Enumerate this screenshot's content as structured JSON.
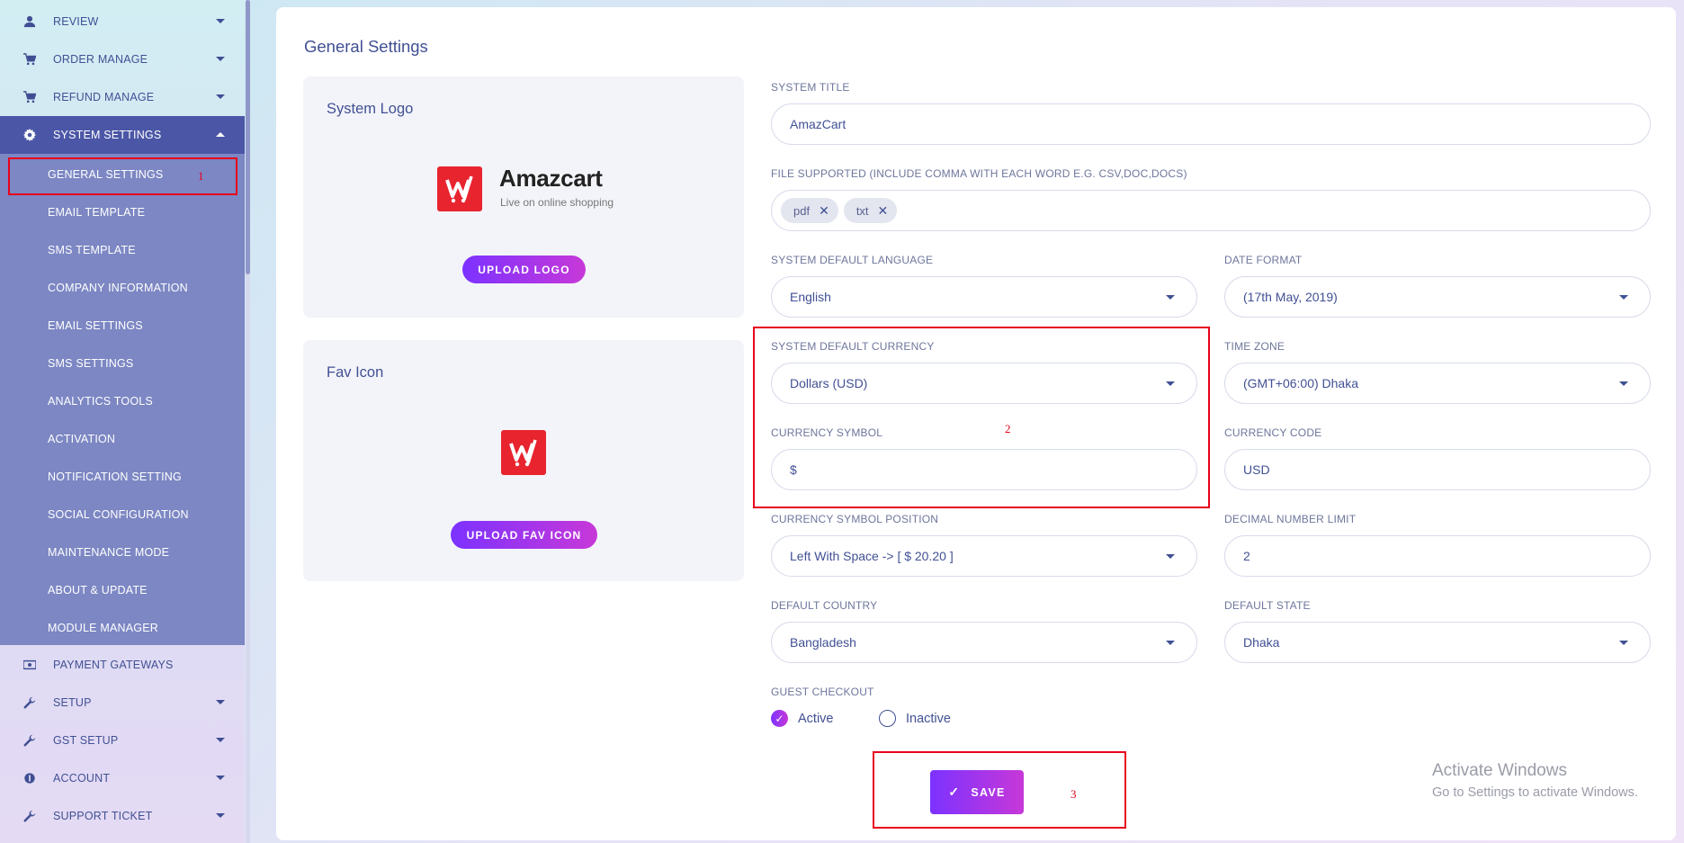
{
  "sidebar": {
    "top_items": [
      {
        "label": "REVIEW",
        "icon": "user-icon",
        "has_caret": true
      },
      {
        "label": "ORDER MANAGE",
        "icon": "cart-icon",
        "has_caret": true
      },
      {
        "label": "REFUND MANAGE",
        "icon": "cart-icon",
        "has_caret": true
      },
      {
        "label": "SYSTEM SETTINGS",
        "icon": "gear-icon",
        "has_caret": true,
        "active": true
      }
    ],
    "submenu": [
      "GENERAL SETTINGS",
      "EMAIL TEMPLATE",
      "SMS TEMPLATE",
      "COMPANY INFORMATION",
      "EMAIL SETTINGS",
      "SMS SETTINGS",
      "ANALYTICS TOOLS",
      "ACTIVATION",
      "NOTIFICATION SETTING",
      "SOCIAL CONFIGURATION",
      "MAINTENANCE MODE",
      "ABOUT & UPDATE",
      "MODULE MANAGER"
    ],
    "bottom_items": [
      {
        "label": "PAYMENT GATEWAYS",
        "icon": "money-icon",
        "has_caret": false
      },
      {
        "label": "SETUP",
        "icon": "wrench-icon",
        "has_caret": true
      },
      {
        "label": "GST SETUP",
        "icon": "wrench-icon",
        "has_caret": true
      },
      {
        "label": "ACCOUNT",
        "icon": "coin-icon",
        "has_caret": true
      },
      {
        "label": "SUPPORT TICKET",
        "icon": "wrench-icon",
        "has_caret": true
      }
    ]
  },
  "page": {
    "title": "General Settings"
  },
  "logo_panel": {
    "title": "System Logo",
    "brand_name": "Amazcart",
    "brand_tagline": "Live on online shopping",
    "upload_label": "UPLOAD LOGO"
  },
  "fav_panel": {
    "title": "Fav Icon",
    "upload_label": "UPLOAD FAV ICON"
  },
  "form": {
    "system_title": {
      "label": "SYSTEM TITLE",
      "value": "AmazCart"
    },
    "file_supported": {
      "label": "FILE SUPPORTED (INCLUDE COMMA WITH EACH WORD E.G. CSV,DOC,DOCS)",
      "tags": [
        "pdf",
        "txt"
      ]
    },
    "language": {
      "label": "SYSTEM DEFAULT LANGUAGE",
      "value": "English"
    },
    "date_format": {
      "label": "DATE FORMAT",
      "value": "(17th May, 2019)"
    },
    "currency": {
      "label": "SYSTEM DEFAULT CURRENCY",
      "value": "Dollars (USD)"
    },
    "time_zone": {
      "label": "TIME ZONE",
      "value": "(GMT+06:00) Dhaka"
    },
    "currency_symbol": {
      "label": "CURRENCY SYMBOL",
      "value": "$"
    },
    "currency_code": {
      "label": "CURRENCY CODE",
      "value": "USD"
    },
    "symbol_position": {
      "label": "CURRENCY SYMBOL POSITION",
      "value": "Left With Space -> [ $ 20.20 ]"
    },
    "decimal_limit": {
      "label": "DECIMAL NUMBER LIMIT",
      "value": "2"
    },
    "country": {
      "label": "DEFAULT COUNTRY",
      "value": "Bangladesh"
    },
    "state": {
      "label": "DEFAULT STATE",
      "value": "Dhaka"
    },
    "guest_checkout": {
      "label": "GUEST CHECKOUT",
      "options": [
        "Active",
        "Inactive"
      ],
      "selected": "Active"
    },
    "save_label": "SAVE"
  },
  "annotations": {
    "n1": "1",
    "n2": "2",
    "n3": "3"
  },
  "watermark": {
    "title": "Activate Windows",
    "subtitle": "Go to Settings to activate Windows."
  },
  "colors": {
    "accent_start": "#7c32ff",
    "accent_end": "#c738d8",
    "sidebar_active": "#4b56a6",
    "submenu_bg": "#7c87c3",
    "annotation_red": "#e8001c",
    "brand_red": "#e8242f"
  }
}
